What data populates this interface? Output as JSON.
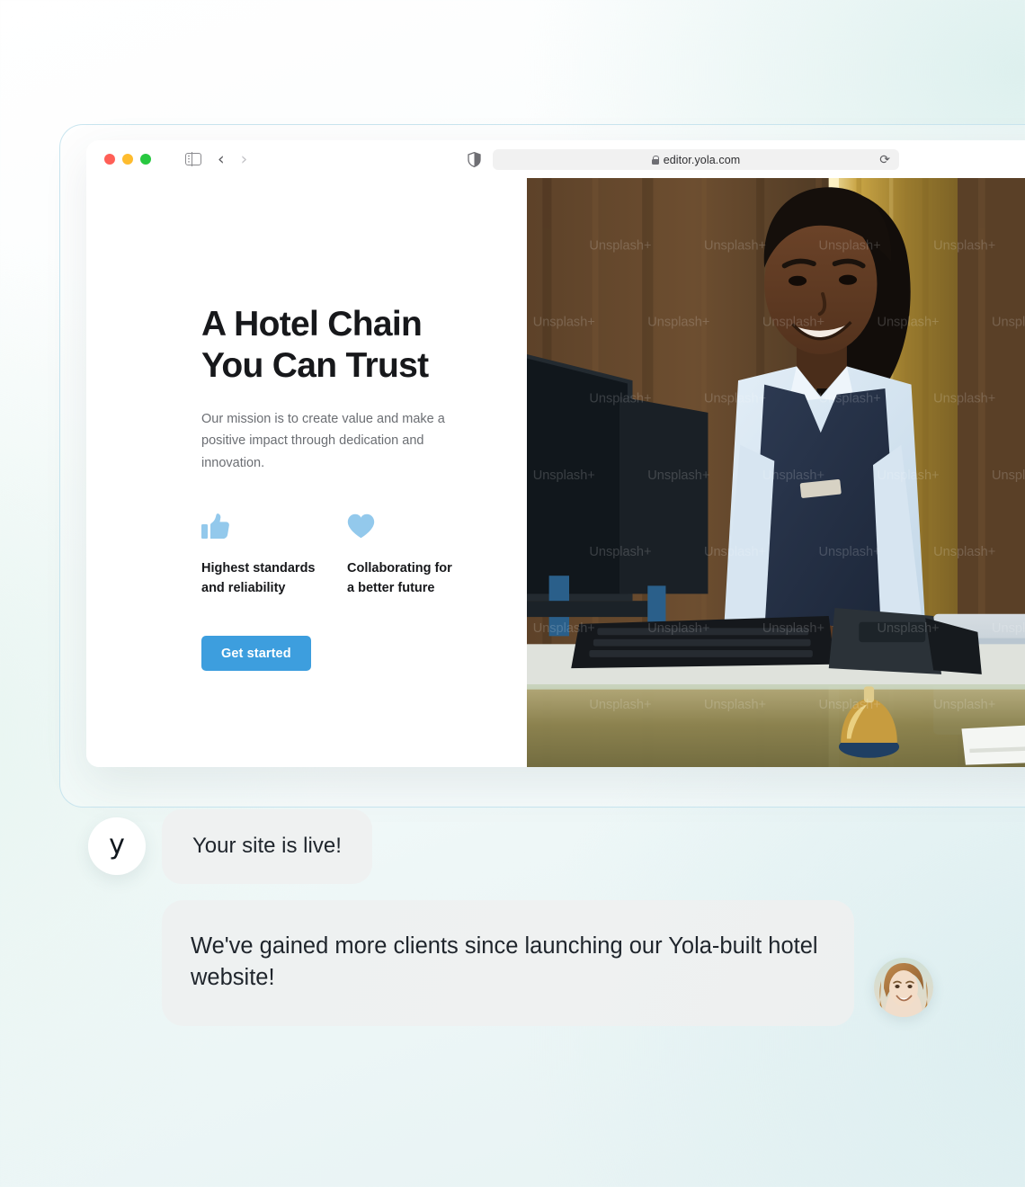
{
  "browser": {
    "traffic_lights": [
      "close",
      "minimize",
      "maximize"
    ],
    "sidebar_toggle_name": "sidebar-toggle-icon",
    "back_label": "‹",
    "forward_label": "›",
    "url": "editor.yola.com",
    "reload_label": "⟳"
  },
  "site": {
    "hero": {
      "title": "A Hotel Chain\nYou Can Trust",
      "subtitle": "Our mission is to create value and make a positive impact through dedication and innovation.",
      "cta_label": "Get started",
      "cta_color": "#3d9ede",
      "features": [
        {
          "icon": "thumbs-up-icon",
          "label": "Highest standards\nand reliability"
        },
        {
          "icon": "heart-icon",
          "label": "Collaborating for\na better future"
        }
      ],
      "icon_color": "#93c9ec",
      "photo_alt": "hotel-receptionist-at-front-desk",
      "photo_watermark": "Unsplash+"
    }
  },
  "chat": {
    "brand_initial": "y",
    "messages": [
      {
        "from": "brand",
        "text": "Your site is live!"
      },
      {
        "from": "customer",
        "text": "We've gained more clients since launching our Yola-built hotel website!"
      }
    ],
    "customer_avatar_alt": "smiling-woman-portrait"
  }
}
